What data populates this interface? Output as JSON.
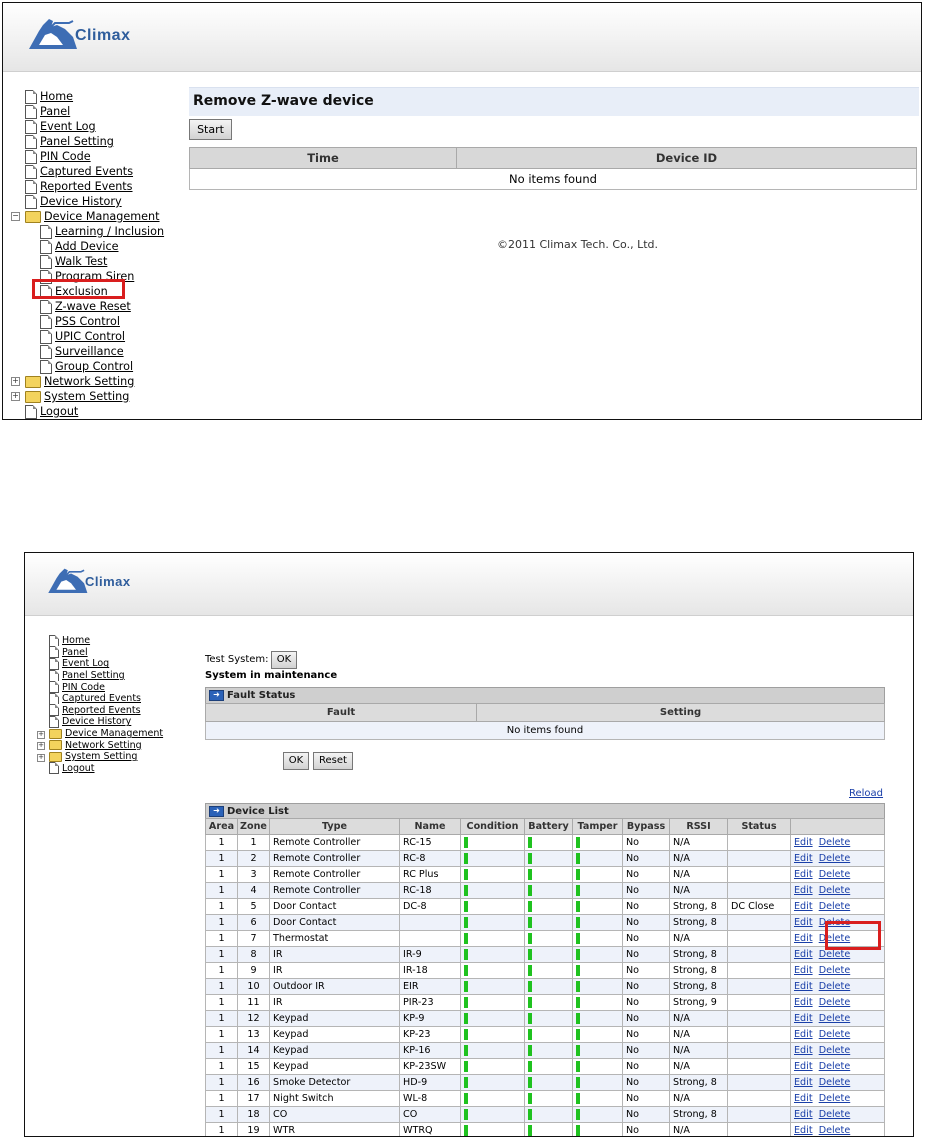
{
  "logo": {
    "text": "Climax"
  },
  "screen1": {
    "menu": [
      {
        "label": "Home",
        "level": 0
      },
      {
        "label": "Panel",
        "level": 0
      },
      {
        "label": "Event Log",
        "level": 0
      },
      {
        "label": "Panel Setting",
        "level": 0
      },
      {
        "label": "PIN Code",
        "level": 0
      },
      {
        "label": "Captured Events",
        "level": 0
      },
      {
        "label": "Reported Events",
        "level": 0
      },
      {
        "label": "Device History",
        "level": 0
      },
      {
        "label": "Device Management",
        "level": 0,
        "folder": true,
        "expander": "−"
      },
      {
        "label": "Learning / Inclusion",
        "level": 1
      },
      {
        "label": "Add Device",
        "level": 1
      },
      {
        "label": "Walk Test",
        "level": 1
      },
      {
        "label": "Program Siren",
        "level": 1
      },
      {
        "label": "Exclusion",
        "level": 1,
        "highlight": true
      },
      {
        "label": "Z-wave Reset",
        "level": 1
      },
      {
        "label": "PSS Control",
        "level": 1
      },
      {
        "label": "UPIC Control",
        "level": 1
      },
      {
        "label": "Surveillance",
        "level": 1
      },
      {
        "label": "Group Control",
        "level": 1
      },
      {
        "label": "Network Setting",
        "level": 0,
        "folder": true,
        "expander": "+"
      },
      {
        "label": "System Setting",
        "level": 0,
        "folder": true,
        "expander": "+"
      },
      {
        "label": "Logout",
        "level": 0
      }
    ],
    "page_title": "Remove Z-wave device",
    "start_label": "Start",
    "table": {
      "headers": [
        "Time",
        "Device ID"
      ],
      "empty": "No items found"
    },
    "copyright": "©2011 Climax Tech. Co., Ltd."
  },
  "screen2": {
    "menu": [
      {
        "label": "Home"
      },
      {
        "label": "Panel"
      },
      {
        "label": "Event Log"
      },
      {
        "label": "Panel Setting"
      },
      {
        "label": "PIN Code"
      },
      {
        "label": "Captured Events"
      },
      {
        "label": "Reported Events"
      },
      {
        "label": "Device History"
      },
      {
        "label": "Device Management",
        "folder": true,
        "expander": "+"
      },
      {
        "label": "Network Setting",
        "folder": true,
        "expander": "+"
      },
      {
        "label": "System Setting",
        "folder": true,
        "expander": "+"
      },
      {
        "label": "Logout"
      }
    ],
    "test_system_label": "Test System:",
    "ok_label": "OK",
    "maintenance_text": "System in maintenance",
    "fault_status_title": "Fault Status",
    "fault_headers": [
      "Fault",
      "Setting"
    ],
    "fault_empty": "No items found",
    "reset_label": "Reset",
    "reload_label": "Reload",
    "device_list_title": "Device List",
    "device_headers": [
      "Area",
      "Zone",
      "Type",
      "Name",
      "Condition",
      "Battery",
      "Tamper",
      "Bypass",
      "RSSI",
      "Status",
      ""
    ],
    "edit_label": "Edit",
    "delete_label": "Delete",
    "status_color": "#1fc21f",
    "devices": [
      {
        "area": "1",
        "zone": "1",
        "type": "Remote Controller",
        "name": "RC-15",
        "bypass": "No",
        "rssi": "N/A",
        "status": ""
      },
      {
        "area": "1",
        "zone": "2",
        "type": "Remote Controller",
        "name": "RC-8",
        "bypass": "No",
        "rssi": "N/A",
        "status": ""
      },
      {
        "area": "1",
        "zone": "3",
        "type": "Remote Controller",
        "name": "RC Plus",
        "bypass": "No",
        "rssi": "N/A",
        "status": ""
      },
      {
        "area": "1",
        "zone": "4",
        "type": "Remote Controller",
        "name": "RC-18",
        "bypass": "No",
        "rssi": "N/A",
        "status": ""
      },
      {
        "area": "1",
        "zone": "5",
        "type": "Door Contact",
        "name": "DC-8",
        "bypass": "No",
        "rssi": "Strong, 8",
        "status": "DC Close"
      },
      {
        "area": "1",
        "zone": "6",
        "type": "Door Contact",
        "name": "",
        "bypass": "No",
        "rssi": "Strong, 8",
        "status": ""
      },
      {
        "area": "1",
        "zone": "7",
        "type": "Thermostat",
        "name": "",
        "bypass": "No",
        "rssi": "N/A",
        "status": "",
        "highlight_delete": true
      },
      {
        "area": "1",
        "zone": "8",
        "type": "IR",
        "name": "IR-9",
        "bypass": "No",
        "rssi": "Strong, 8",
        "status": ""
      },
      {
        "area": "1",
        "zone": "9",
        "type": "IR",
        "name": "IR-18",
        "bypass": "No",
        "rssi": "Strong, 8",
        "status": ""
      },
      {
        "area": "1",
        "zone": "10",
        "type": "Outdoor IR",
        "name": "EIR",
        "bypass": "No",
        "rssi": "Strong, 8",
        "status": ""
      },
      {
        "area": "1",
        "zone": "11",
        "type": "IR",
        "name": "PIR-23",
        "bypass": "No",
        "rssi": "Strong, 9",
        "status": ""
      },
      {
        "area": "1",
        "zone": "12",
        "type": "Keypad",
        "name": "KP-9",
        "bypass": "No",
        "rssi": "N/A",
        "status": ""
      },
      {
        "area": "1",
        "zone": "13",
        "type": "Keypad",
        "name": "KP-23",
        "bypass": "No",
        "rssi": "N/A",
        "status": ""
      },
      {
        "area": "1",
        "zone": "14",
        "type": "Keypad",
        "name": "KP-16",
        "bypass": "No",
        "rssi": "N/A",
        "status": ""
      },
      {
        "area": "1",
        "zone": "15",
        "type": "Keypad",
        "name": "KP-23SW",
        "bypass": "No",
        "rssi": "N/A",
        "status": ""
      },
      {
        "area": "1",
        "zone": "16",
        "type": "Smoke Detector",
        "name": "HD-9",
        "bypass": "No",
        "rssi": "Strong, 8",
        "status": ""
      },
      {
        "area": "1",
        "zone": "17",
        "type": "Night Switch",
        "name": "WL-8",
        "bypass": "No",
        "rssi": "N/A",
        "status": ""
      },
      {
        "area": "1",
        "zone": "18",
        "type": "CO",
        "name": "CO",
        "bypass": "No",
        "rssi": "Strong, 8",
        "status": ""
      },
      {
        "area": "1",
        "zone": "19",
        "type": "WTR",
        "name": "WTRQ",
        "bypass": "No",
        "rssi": "N/A",
        "status": ""
      }
    ]
  }
}
